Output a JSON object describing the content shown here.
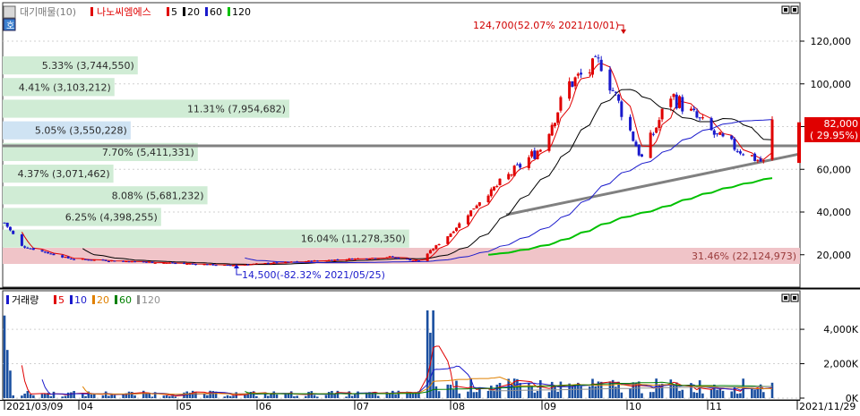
{
  "price_panel": {
    "legend": {
      "prefix_label": "대기매물(10)",
      "stock_name": "나노씨엠에스",
      "ma_items": [
        {
          "label": "5",
          "color": "#e00000"
        },
        {
          "label": "20",
          "color": "#000000"
        },
        {
          "label": "60",
          "color": "#1a1acc"
        },
        {
          "label": "120",
          "color": "#00c000"
        }
      ]
    },
    "max_annotation": "124,700(52.07% 2021/10/01)",
    "min_annotation": "14,500(-82.32% 2021/05/25)",
    "last_price": "82,000",
    "last_change": "( 29.95%)",
    "y_ticks": [
      "120,000",
      "100,000",
      "80,000",
      "60,000",
      "40,000",
      "20,000"
    ]
  },
  "volume_panel": {
    "legend": {
      "title": "거래량",
      "ma_items": [
        {
          "label": "5",
          "color": "#e00000"
        },
        {
          "label": "10",
          "color": "#1a1acc"
        },
        {
          "label": "20",
          "color": "#e08000"
        },
        {
          "label": "60",
          "color": "#008000"
        },
        {
          "label": "120",
          "color": "#909090"
        }
      ]
    },
    "y_ticks": [
      "4,000K",
      "2,000K",
      "0K"
    ]
  },
  "x_axis": {
    "ticks": [
      "2021/03/09",
      "04",
      "05",
      "06",
      "07",
      "08",
      "09",
      "10",
      "11",
      "2021/11/29"
    ]
  },
  "chart_data": {
    "type": "candlestick",
    "volume_profile": {
      "title": "대기매물(10)",
      "bins": [
        {
          "label": "5.33% (3,744,550)",
          "pct": 5.33,
          "volume": 3744550,
          "highlight": false
        },
        {
          "label": "4.41% (3,103,212)",
          "pct": 4.41,
          "volume": 3103212,
          "highlight": false
        },
        {
          "label": "11.31% (7,954,682)",
          "pct": 11.31,
          "volume": 7954682,
          "highlight": false
        },
        {
          "label": "5.05% (3,550,228)",
          "pct": 5.05,
          "volume": 3550228,
          "highlight": "current"
        },
        {
          "label": "7.70% (5,411,331)",
          "pct": 7.7,
          "volume": 5411331,
          "highlight": false
        },
        {
          "label": "4.37% (3,071,462)",
          "pct": 4.37,
          "volume": 3071462,
          "highlight": false
        },
        {
          "label": "8.08% (5,681,232)",
          "pct": 8.08,
          "volume": 5681232,
          "highlight": false
        },
        {
          "label": "6.25% (4,398,255)",
          "pct": 6.25,
          "volume": 4398255,
          "highlight": false
        },
        {
          "label": "16.04% (11,278,350)",
          "pct": 16.04,
          "volume": 11278350,
          "highlight": false
        },
        {
          "label": "31.46% (22,124,973)",
          "pct": 31.46,
          "volume": 22124973,
          "highlight": "max"
        }
      ]
    },
    "ohlc_keypoints": [
      {
        "date": "2021-03-09",
        "close": 35000
      },
      {
        "date": "2021-03-15",
        "close": 24000
      },
      {
        "date": "2021-04-01",
        "close": 18000
      },
      {
        "date": "2021-05-25",
        "close": 15000,
        "low": 14500
      },
      {
        "date": "2021-07-20",
        "close": 19000
      },
      {
        "date": "2021-07-30",
        "close": 17000
      },
      {
        "date": "2021-08-10",
        "close": 30000
      },
      {
        "date": "2021-08-20",
        "close": 45000
      },
      {
        "date": "2021-09-10",
        "close": 70000
      },
      {
        "date": "2021-09-20",
        "close": 100000
      },
      {
        "date": "2021-10-01",
        "close": 110000,
        "high": 124700
      },
      {
        "date": "2021-10-15",
        "close": 65000
      },
      {
        "date": "2021-10-25",
        "close": 95000
      },
      {
        "date": "2021-11-10",
        "close": 75000
      },
      {
        "date": "2021-11-26",
        "close": 63000
      },
      {
        "date": "2021-11-29",
        "close": 82000
      }
    ],
    "ylim": [
      12000,
      134000
    ],
    "volume_ylim": [
      0,
      5200
    ],
    "volume_unit": "K",
    "volume_keypoints": [
      {
        "date": "2021-03-09",
        "value": 4800
      },
      {
        "date": "2021-08-02",
        "value": 5100
      },
      {
        "date": "2021-11-29",
        "value": 600
      }
    ]
  }
}
